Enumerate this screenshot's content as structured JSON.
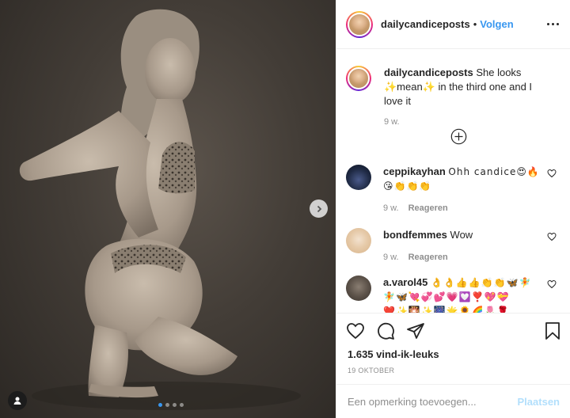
{
  "post": {
    "username": "dailycandiceposts",
    "separator": "•",
    "follow_label": "Volgen",
    "more_icon": "more-options-icon",
    "carousel": {
      "slides": 4,
      "active_index": 0
    }
  },
  "caption": {
    "username": "dailycandiceposts",
    "line1": "She looks",
    "line2": "✨mean✨ in the third one and I love it",
    "time": "9 w."
  },
  "load_more_icon": "plus-circle-icon",
  "comments": [
    {
      "username": "ceppikayhan",
      "text": "Ohh candice😍🔥",
      "text2": "😘👏👏👏",
      "time": "9 w.",
      "reply": "Reageren"
    },
    {
      "username": "bondfemmes",
      "text": "Wow",
      "time": "9 w.",
      "reply": "Reageren"
    },
    {
      "username": "a.varol45",
      "text": "👌👌👍👍👏👏🦋🧚",
      "text2": "🧚🦋💘💞💕💗💟❣️💖💝",
      "text3": "❤️✨🎇✨🎆🌟🌻🌈🌷🌹"
    }
  ],
  "actions": {
    "likes": "1.635 vind-ik-leuks",
    "date": "19 OKTOBER",
    "comment_placeholder": "Een opmerking toevoegen...",
    "post_label": "Plaatsen"
  },
  "colors": {
    "accent": "#3897f0",
    "post_disabled": "#b2dffc",
    "muted": "#8e8e8e",
    "text": "#262626"
  }
}
